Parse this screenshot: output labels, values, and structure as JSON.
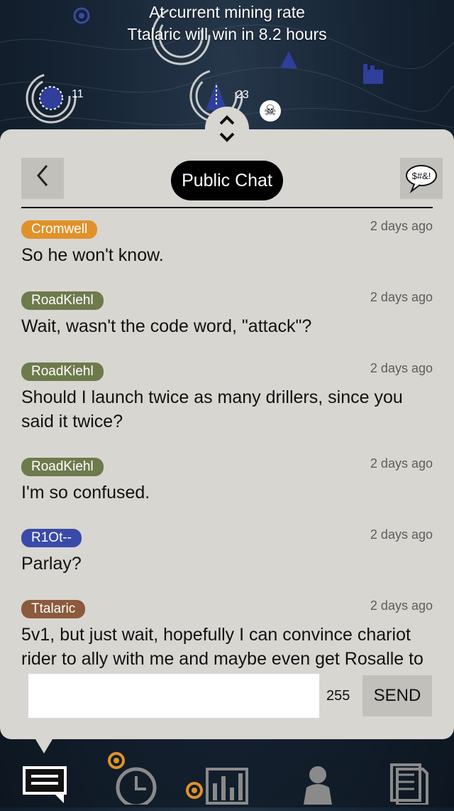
{
  "map": {
    "banner_line1": "At current mining rate",
    "banner_line2": "Ttalaric will win in 8.2 hours",
    "node_counts": [
      "11",
      "23"
    ],
    "icons": [
      "ring-node-icon",
      "driller-icon",
      "skull-icon",
      "factory-icon"
    ]
  },
  "chat": {
    "title": "Public Chat",
    "back_icon": "chevron-left-icon",
    "swear_label": "$#&!",
    "messages": [
      {
        "user": "Cromwell",
        "color": "#e0922a",
        "time": "2 days ago",
        "text": "So he won't know."
      },
      {
        "user": "RoadKiehl",
        "color": "#6d7a4c",
        "time": "2 days ago",
        "text": "Wait, wasn't the code word, \"attack\"?"
      },
      {
        "user": "RoadKiehl",
        "color": "#6d7a4c",
        "time": "2 days ago",
        "text": "Should I launch twice as many drillers, since you said it twice?"
      },
      {
        "user": "RoadKiehl",
        "color": "#6d7a4c",
        "time": "2 days ago",
        "text": "I'm so confused."
      },
      {
        "user": "R1Ot--",
        "color": "#3a4aa8",
        "time": "2 days ago",
        "text": "Parlay?"
      },
      {
        "user": "Ttalaric",
        "color": "#8c5a3c",
        "time": "2 days ago",
        "text": "5v1, but just wait, hopefully I can convince chariot rider to ally with me and maybe even get Rosalle to send some encouraging words from the grave"
      }
    ],
    "input_value": "",
    "char_count": "255",
    "send_label": "SEND"
  },
  "tabs": [
    {
      "name": "chat-tab",
      "icon": "chat-icon"
    },
    {
      "name": "history-tab",
      "icon": "clock-icon"
    },
    {
      "name": "stats-tab",
      "icon": "bar-chart-icon"
    },
    {
      "name": "players-tab",
      "icon": "person-icon"
    },
    {
      "name": "log-tab",
      "icon": "document-icon"
    }
  ],
  "colors": {
    "accent_orange": "#e0922a",
    "panel": "#d8d6d1",
    "node_blue": "#3a4aa8"
  }
}
